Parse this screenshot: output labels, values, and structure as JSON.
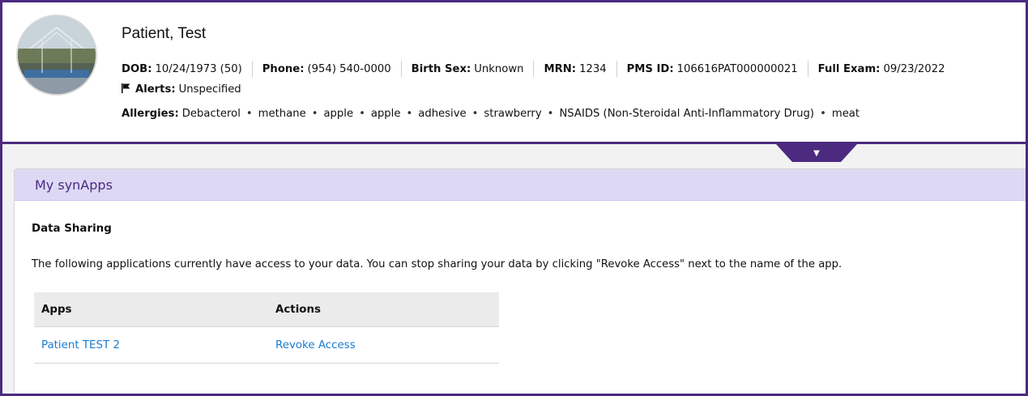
{
  "patient": {
    "name": "Patient, Test",
    "dob_label": "DOB:",
    "dob_value": "10/24/1973 (50)",
    "phone_label": "Phone:",
    "phone_value": "(954) 540-0000",
    "birth_sex_label": "Birth Sex:",
    "birth_sex_value": "Unknown",
    "mrn_label": "MRN:",
    "mrn_value": "1234",
    "pms_id_label": "PMS ID:",
    "pms_id_value": "106616PAT000000021",
    "full_exam_label": "Full Exam:",
    "full_exam_value": "09/23/2022",
    "alerts_label": "Alerts:",
    "alerts_value": "Unspecified",
    "allergies_label": "Allergies:",
    "allergies": [
      "Debacterol",
      "methane",
      "apple",
      "apple",
      "adhesive",
      "strawberry",
      "NSAIDS (Non-Steroidal Anti-Inflammatory Drug)",
      "meat"
    ]
  },
  "icons": {
    "flag": "flag-icon",
    "toggle": "chevron-down-icon"
  },
  "panel": {
    "title": "My synApps",
    "section_title": "Data Sharing",
    "description": "The following applications currently have access to your data. You can stop sharing your data by clicking \"Revoke Access\" next to the name of the app.",
    "table": {
      "headers": [
        "Apps",
        "Actions"
      ],
      "rows": [
        {
          "app": "Patient TEST 2",
          "action": "Revoke Access"
        }
      ]
    }
  },
  "colors": {
    "brand_purple": "#4b2a80",
    "panel_header_bg": "#ddd9f5",
    "link_blue": "#1a7bd0"
  }
}
